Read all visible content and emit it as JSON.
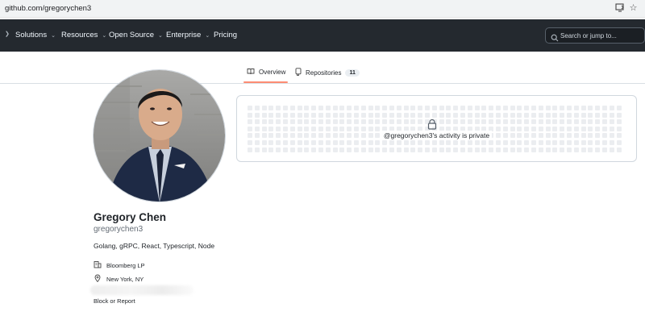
{
  "browser": {
    "url": "github.com/gregorychen3",
    "icons": [
      "install-app-icon",
      "bookmark-star-icon"
    ]
  },
  "header": {
    "nav": [
      {
        "label": "Solutions",
        "dropdown": true
      },
      {
        "label": "Resources",
        "dropdown": true
      },
      {
        "label": "Open Source",
        "dropdown": true
      },
      {
        "label": "Enterprise",
        "dropdown": true
      },
      {
        "label": "Pricing",
        "dropdown": false
      }
    ],
    "search_placeholder": "Search or jump to..."
  },
  "tabs": [
    {
      "label": "Overview",
      "icon": "book-icon",
      "active": true
    },
    {
      "label": "Repositories",
      "icon": "repo-icon",
      "count": "11",
      "active": false
    }
  ],
  "profile": {
    "name": "Gregory Chen",
    "login": "gregorychen3",
    "bio": "Golang, gRPC, React, Typescript, Node",
    "organization": "Bloomberg LP",
    "location": "New York, NY",
    "block_report": "Block or Report"
  },
  "activity": {
    "message": "@gregorychen3's activity is private",
    "icon": "lock-icon"
  },
  "colors": {
    "header_bg": "#24292f",
    "tab_accent": "#fd8c73",
    "grid_cell": "#ebedf0"
  }
}
